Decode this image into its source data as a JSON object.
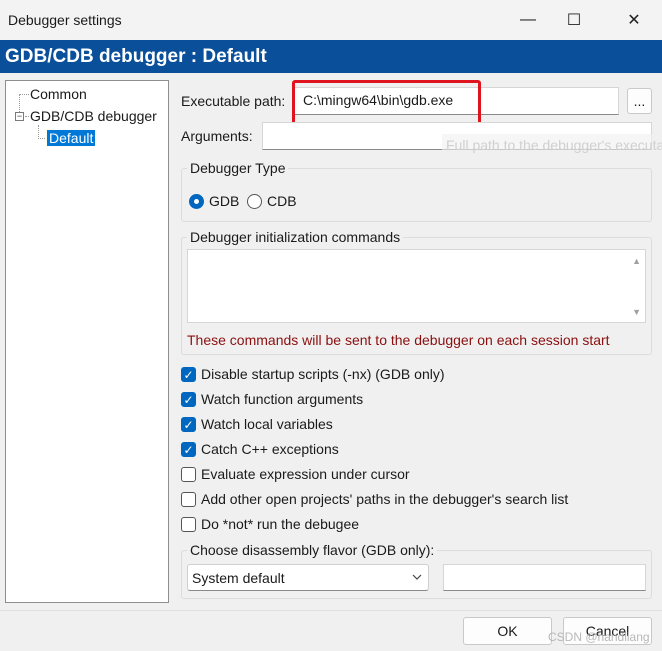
{
  "window": {
    "title": "Debugger settings",
    "minimize_glyph": "—",
    "maximize_glyph": "☐",
    "close_glyph": "✕"
  },
  "header": {
    "title": "GDB/CDB debugger : Default"
  },
  "tree": {
    "items": [
      {
        "label": "Common"
      },
      {
        "label": "GDB/CDB debugger",
        "expanded": true
      },
      {
        "label": "Default",
        "selected": true
      }
    ],
    "expander_glyph": "−"
  },
  "executable": {
    "label": "Executable path:",
    "value": "C:\\mingw64\\bin\\gdb.exe",
    "browse_label": "...",
    "tooltip": "Full path to the debugger's executable"
  },
  "arguments": {
    "label": "Arguments:",
    "value": ""
  },
  "debugger_type": {
    "title": "Debugger Type",
    "options": [
      "GDB",
      "CDB"
    ],
    "selected": "GDB"
  },
  "init_commands": {
    "title": "Debugger initialization commands",
    "value": "",
    "note": "These commands will be sent to the debugger on each session start"
  },
  "checkboxes": [
    {
      "label": "Disable startup scripts (-nx) (GDB only)",
      "checked": true
    },
    {
      "label": "Watch function arguments",
      "checked": true
    },
    {
      "label": "Watch local variables",
      "checked": true
    },
    {
      "label": "Catch C++ exceptions",
      "checked": true
    },
    {
      "label": "Evaluate expression under cursor",
      "checked": false
    },
    {
      "label": "Add other open projects' paths in the debugger's search list",
      "checked": false
    },
    {
      "label": "Do *not* run the debugee",
      "checked": false
    }
  ],
  "disassembly": {
    "title": "Choose disassembly flavor (GDB only):",
    "selected": "System default",
    "extra_value": ""
  },
  "footer": {
    "ok_label": "OK",
    "cancel_label": "Cancel",
    "watermark": "CSDN @handliang"
  },
  "colors": {
    "header_bg": "#0a4f9a",
    "accent": "#0067c0",
    "highlight_box": "#e0141e",
    "note_text": "#8b0f0f"
  }
}
